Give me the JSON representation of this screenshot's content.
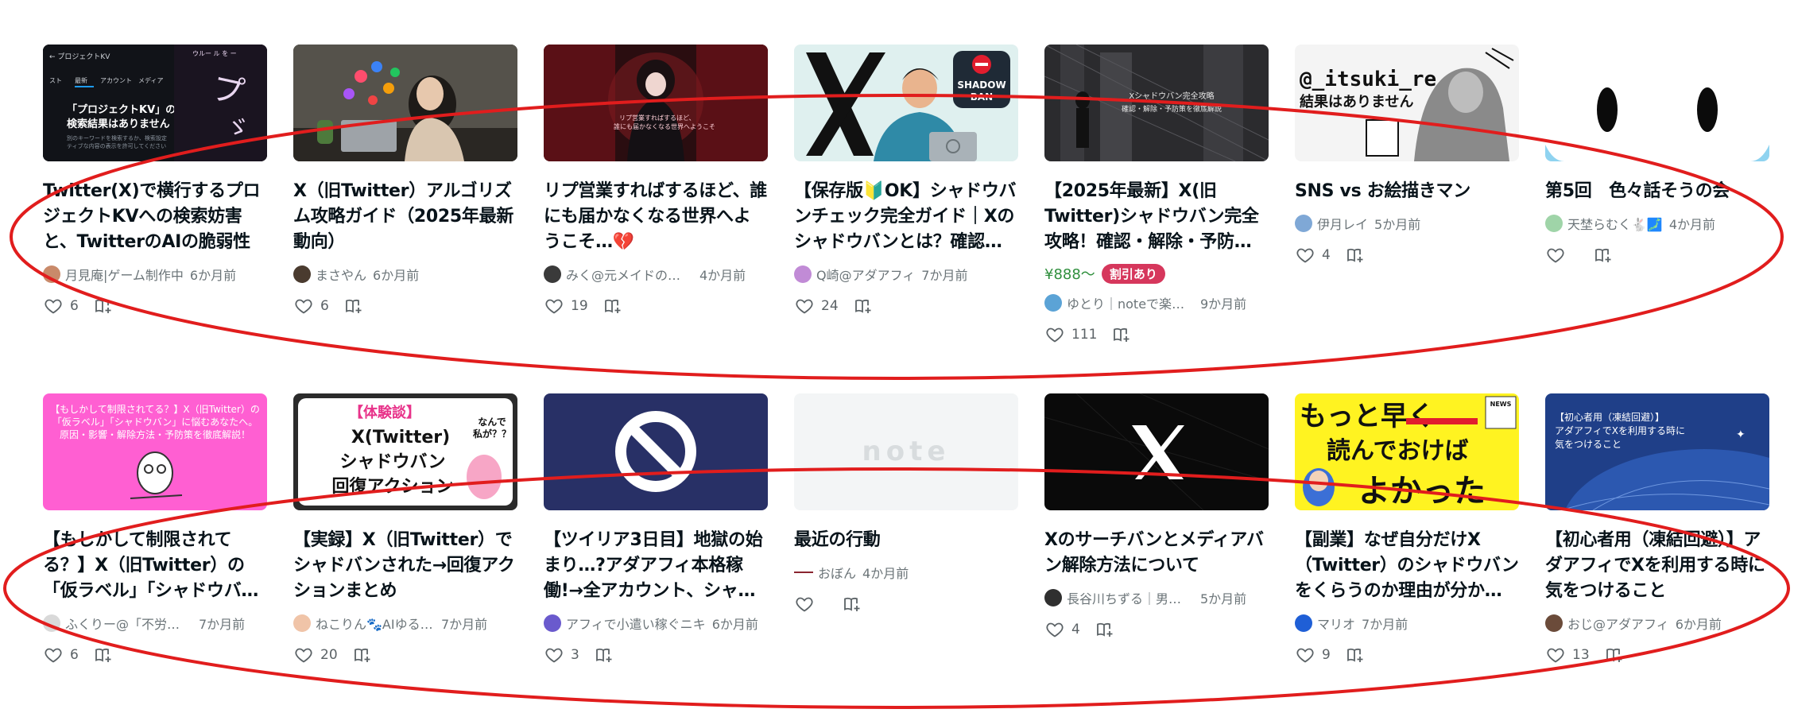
{
  "cards_row1": [
    {
      "thumb_icon": "search-results-thumbnail",
      "thumb_text": "「プロジェクトKV」の検索結果はありません",
      "title": "Twitter(X)で横行するプロジェクトKVへの検索妨害と、TwitterのAIの脆弱性",
      "author": "月見庵|ゲーム制作中",
      "time": "6か月前",
      "likes": "6"
    },
    {
      "thumb_icon": "woman-with-phone-thumbnail",
      "title": "X（旧Twitter）アルゴリズム攻略ガイド（2025年最新動向）",
      "author": "まさやん",
      "time": "6か月前",
      "likes": "6"
    },
    {
      "thumb_icon": "gothic-girl-thumbnail",
      "title": "リプ営業すればするほど、誰にも届かなくなる世界へようこそ…",
      "title_emoji": "💔",
      "author": "みく@元メイドのコン…",
      "time": "4か月前",
      "likes": "19"
    },
    {
      "thumb_icon": "shadow-ban-x-thumbnail",
      "thumb_text": "SHADOW BAN",
      "title": "【保存版🔰OK】シャドウバンチェック完全ガイド｜Xのシャドウバンとは？確認方法…",
      "author": "Q崎@アダアフィ",
      "time": "7か月前",
      "likes": "24"
    },
    {
      "thumb_icon": "dark-city-thumbnail",
      "thumb_text": "Xシャドウバン完全攻略",
      "title": "【2025年最新】X(旧Twitter)シャドウバン完全攻略！確認・解除・予防策を徹底解説",
      "price": "¥888〜",
      "badge": "割引あり",
      "author": "ゆとり｜noteで楽する…",
      "time": "9か月前",
      "likes": "111"
    },
    {
      "thumb_icon": "manga-thumbnail",
      "thumb_text": "@_itsuki_re 結果はありません",
      "title": "SNS vs お絵描きマン",
      "author": "伊月レイ",
      "time": "5か月前",
      "likes": "4"
    },
    {
      "thumb_icon": "face-thumbnail",
      "title": "第5回　色々話そうの会",
      "author": "天埜らむく🐇🗾",
      "time": "4か月前",
      "likes": ""
    }
  ],
  "cards_row2": [
    {
      "thumb_icon": "owl-pink-thumbnail",
      "thumb_text": "【もしかして制限されてる？】X（旧Twitter）の「仮ラベル」「シャドウバン」に悩むあなたへ。原因・影響・解除方法・予防策を徹底解説！",
      "title": "【もしかして制限されてる？】X（旧Twitter）の「仮ラベル」「シャドウバン」に悩むあな…",
      "author": "ふくりー@「不労所得…",
      "time": "7か月前",
      "likes": "6"
    },
    {
      "thumb_icon": "experience-thumbnail",
      "thumb_text": "【体験談】 X(Twitter) シャドウバン 回復アクション",
      "title": "【実録】X（旧Twitter）でシャドバンされた→回復アクションまとめ",
      "author": "ねこりん🐾AIゆる副業 …",
      "time": "7か月前",
      "likes": "20"
    },
    {
      "thumb_icon": "prohibited-thumbnail",
      "title": "【ツイリア3日目】地獄の始まり…?アダアフィ本格稼働!→全アカウント、シャドウバ…",
      "author": "アフィで小遣い稼ぐニキ",
      "time": "6か月前",
      "likes": "3"
    },
    {
      "thumb_icon": "note-placeholder-thumbnail",
      "thumb_text": "note",
      "title": "最近の行動",
      "author": "おぼん",
      "time": "4か月前",
      "likes": ""
    },
    {
      "thumb_icon": "x-logo-thumbnail",
      "title": "Xのサーチバンとメディアバン解除方法について",
      "author": "長谷川ちずる｜男性機…",
      "time": "5か月前",
      "likes": "4"
    },
    {
      "thumb_icon": "yellow-text-thumbnail",
      "thumb_text_1": "もっと早く",
      "thumb_text_2": "読んでおけば",
      "thumb_text_3": "よかった",
      "thumb_news": "NEWS",
      "title": "【副業】なぜ自分だけX（Twitter）のシャドウバンをくらうのか理由が分かった…",
      "author": "マリオ",
      "time": "7か月前",
      "likes": "9"
    },
    {
      "thumb_icon": "beginner-globe-thumbnail",
      "thumb_text": "【初心者用（凍結回避）】アダアフィでXを利用する時に気をつけること",
      "title": "【初心者用（凍結回避）】アダアフィでXを利用する時に気をつけること",
      "author": "おじ@アダアフィ",
      "time": "6か月前",
      "likes": "13"
    }
  ],
  "colors": {
    "annotation_red": "#e11d1d",
    "price_green": "#2f8f3d",
    "badge_red": "#d6375c",
    "meta_gray": "#6b7478",
    "title_text": "#08131a"
  },
  "icons": {
    "like": "heart-icon",
    "save": "magazine-add-icon"
  }
}
